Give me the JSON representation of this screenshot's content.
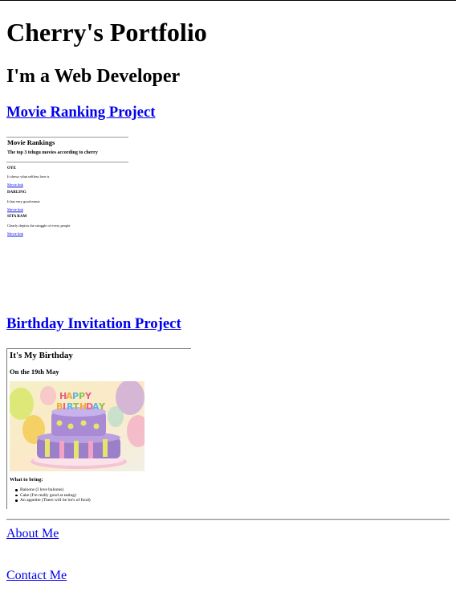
{
  "header": {
    "title": "Cherry's Portfolio",
    "subtitle": "I'm a Web Developer"
  },
  "projects": {
    "movie": {
      "link_label": "Movie Ranking Project",
      "preview": {
        "title": "Movie Rankings",
        "subtitle": "The top 3 telugu movies according to cherry",
        "movies": [
          {
            "name": "OYE",
            "description": "It shows what selfless love is",
            "link_label": "Movie link"
          },
          {
            "name": "DARLING",
            "description": "It has very good music",
            "link_label": "Movie link"
          },
          {
            "name": "SITA RAM",
            "description": "Clearly depicts the struggle of every people",
            "link_label": "Movie link"
          }
        ]
      }
    },
    "birthday": {
      "link_label": "Birthday Invitation Project",
      "preview": {
        "title": "It's My Birthday",
        "date": "On the 19th May",
        "image_icon": "birthday-cake-photo",
        "bring_heading": "What to bring:",
        "items": [
          "Baloons (I love baloons)",
          "Cake (I'm really good at eating)",
          "An appetite (There will be lot's of food)"
        ]
      }
    }
  },
  "footer": {
    "about_label": "About Me",
    "contact_label": "Contact Me"
  },
  "colors": {
    "link": "#0000ee",
    "text": "#000000",
    "background": "#ffffff"
  }
}
